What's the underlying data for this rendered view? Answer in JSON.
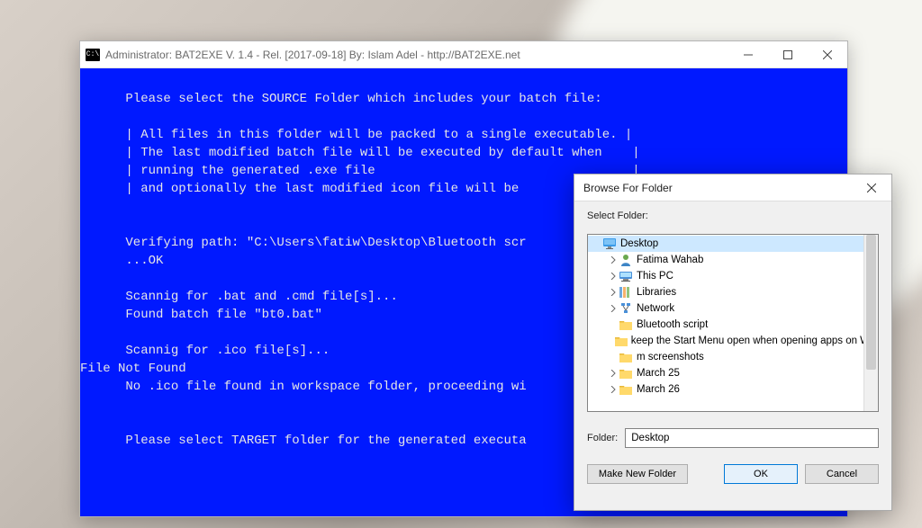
{
  "terminal": {
    "title": "Administrator:  BAT2EXE V. 1.4 - Rel. [2017-09-18] By: Islam Adel - http://BAT2EXE.net",
    "lines": [
      "      Please select the SOURCE Folder which includes your batch file:",
      "",
      "      | All files in this folder will be packed to a single executable. |",
      "      | The last modified batch file will be executed by default when    |",
      "      | running the generated .exe file                                  |",
      "      | and optionally the last modified icon file will be ",
      "",
      "",
      "      Verifying path: \"C:\\Users\\fatiw\\Desktop\\Bluetooth scr",
      "      ...OK",
      "",
      "      Scannig for .bat and .cmd file[s]...",
      "      Found batch file \"bt0.bat\"",
      "",
      "      Scannig for .ico file[s]...",
      "File Not Found",
      "      No .ico file found in workspace folder, proceeding wi",
      "",
      "",
      "      Please select TARGET folder for the generated executa"
    ]
  },
  "dialog": {
    "title": "Browse For Folder",
    "prompt": "Select Folder:",
    "tree": [
      {
        "label": "Desktop",
        "level": 0,
        "icon": "desktop",
        "selected": true,
        "expandable": false
      },
      {
        "label": "Fatima Wahab",
        "level": 1,
        "icon": "user",
        "expandable": true
      },
      {
        "label": "This PC",
        "level": 1,
        "icon": "pc",
        "expandable": true
      },
      {
        "label": "Libraries",
        "level": 1,
        "icon": "libraries",
        "expandable": true
      },
      {
        "label": "Network",
        "level": 1,
        "icon": "network",
        "expandable": true
      },
      {
        "label": "Bluetooth script",
        "level": 1,
        "icon": "folder",
        "expandable": false
      },
      {
        "label": "keep the Start Menu open when opening apps on Win",
        "level": 1,
        "icon": "folder",
        "expandable": false
      },
      {
        "label": "m screenshots",
        "level": 1,
        "icon": "folder",
        "expandable": false
      },
      {
        "label": "March 25",
        "level": 1,
        "icon": "folder",
        "expandable": true
      },
      {
        "label": "March 26",
        "level": 1,
        "icon": "folder",
        "expandable": true
      }
    ],
    "folder_label": "Folder:",
    "folder_value": "Desktop",
    "buttons": {
      "make_new": "Make New Folder",
      "ok": "OK",
      "cancel": "Cancel"
    }
  }
}
